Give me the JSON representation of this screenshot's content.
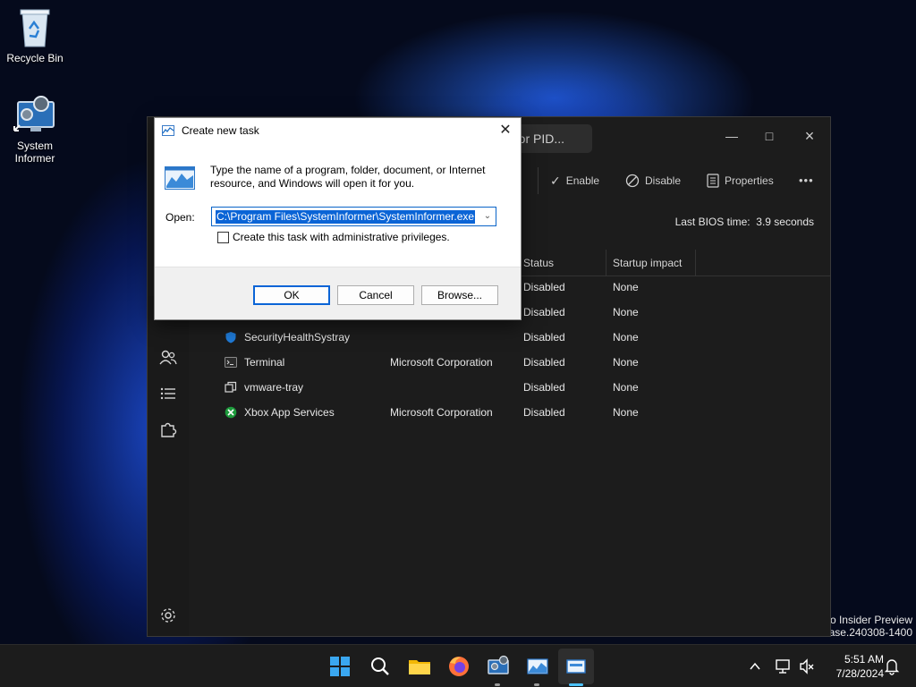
{
  "desktop": {
    "icons": [
      {
        "label": "Recycle Bin"
      },
      {
        "label": "System Informer"
      }
    ],
    "watermark": {
      "line1": "o Insider Preview",
      "line2": "ease.240308-1400"
    }
  },
  "task_manager": {
    "search_placeholder": "r, or PID...",
    "toolbar": {
      "enable": "Enable",
      "disable": "Disable",
      "properties": "Properties",
      "more": "•••"
    },
    "bios_label": "Last BIOS time:",
    "bios_value": "3.9 seconds",
    "columns": {
      "status": "Status",
      "impact": "Startup impact"
    },
    "rows": [
      {
        "name": "",
        "publisher": "",
        "status": "Disabled",
        "impact": "None"
      },
      {
        "name": "",
        "publisher": "",
        "status": "Disabled",
        "impact": "None"
      },
      {
        "name": "SecurityHealthSystray",
        "publisher": "",
        "status": "Disabled",
        "impact": "None"
      },
      {
        "name": "Terminal",
        "publisher": "Microsoft Corporation",
        "status": "Disabled",
        "impact": "None"
      },
      {
        "name": "vmware-tray",
        "publisher": "",
        "status": "Disabled",
        "impact": "None"
      },
      {
        "name": "Xbox App Services",
        "publisher": "Microsoft Corporation",
        "status": "Disabled",
        "impact": "None"
      }
    ]
  },
  "run_dialog": {
    "title": "Create new task",
    "description": "Type the name of a program, folder, document, or Internet resource, and Windows will open it for you.",
    "open_label": "Open:",
    "open_value": "C:\\Program Files\\SystemInformer\\SystemInformer.exe",
    "admin_label": "Create this task with administrative privileges.",
    "ok": "OK",
    "cancel": "Cancel",
    "browse": "Browse..."
  },
  "taskbar": {
    "time": "5:51 AM",
    "date": "7/28/2024"
  },
  "colors": {
    "accent": "#0a64d6",
    "taskbar": "#1c1c1c",
    "taskmgr_bg": "#1c1c1c"
  }
}
